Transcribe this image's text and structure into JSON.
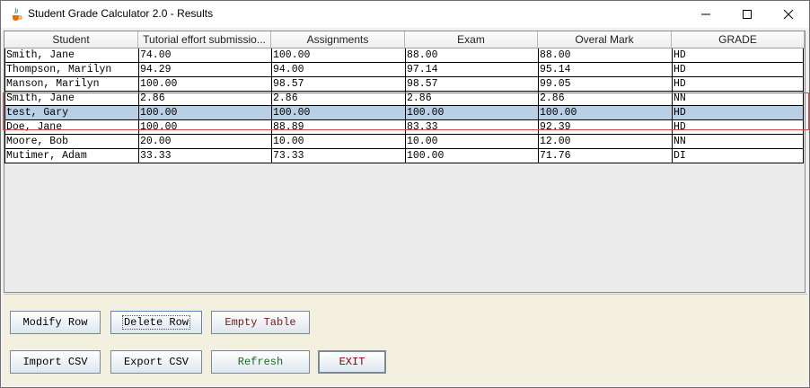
{
  "window": {
    "title": "Student Grade Calculator 2.0 - Results"
  },
  "icons": {
    "app": "java-cup-icon",
    "minimize": "minimize-icon",
    "maximize": "maximize-icon",
    "close": "close-icon"
  },
  "table": {
    "columns": [
      "Student",
      "Tutorial effort submissio...",
      "Assignments",
      "Exam",
      "Overal Mark",
      "GRADE"
    ],
    "rows": [
      [
        "Smith, Jane",
        "74.00",
        "100.00",
        "88.00",
        "88.00",
        "HD"
      ],
      [
        "Thompson, Marilyn",
        "94.29",
        "94.00",
        "97.14",
        "95.14",
        "HD"
      ],
      [
        "Manson, Marilyn",
        "100.00",
        "98.57",
        "98.57",
        "99.05",
        "HD"
      ],
      [
        "Smith, Jane",
        "2.86",
        "2.86",
        "2.86",
        "2.86",
        "NN"
      ],
      [
        "test, Gary",
        "100.00",
        "100.00",
        "100.00",
        "100.00",
        "HD"
      ],
      [
        "Doe, Jane",
        "100.00",
        "88.89",
        "83.33",
        "92.39",
        "HD"
      ],
      [
        "Moore, Bob",
        "20.00",
        "10.00",
        "10.00",
        "12.00",
        "NN"
      ],
      [
        "Mutimer, Adam",
        "33.33",
        "73.33",
        "100.00",
        "71.76",
        "DI"
      ]
    ],
    "selected_row": 4
  },
  "buttons": {
    "modify_row": "Modify Row",
    "delete_row": "Delete Row",
    "empty_table": "Empty Table",
    "import_csv": "Import CSV",
    "export_csv": "Export CSV",
    "refresh": "Refresh",
    "exit": "EXIT"
  },
  "colors": {
    "empty_table_text": "#7a1a1a",
    "refresh_text": "#1f6b1f",
    "exit_text": "#8b0000",
    "selected_row": "#b8cfe5",
    "panel_bg": "#f3f0e0"
  }
}
